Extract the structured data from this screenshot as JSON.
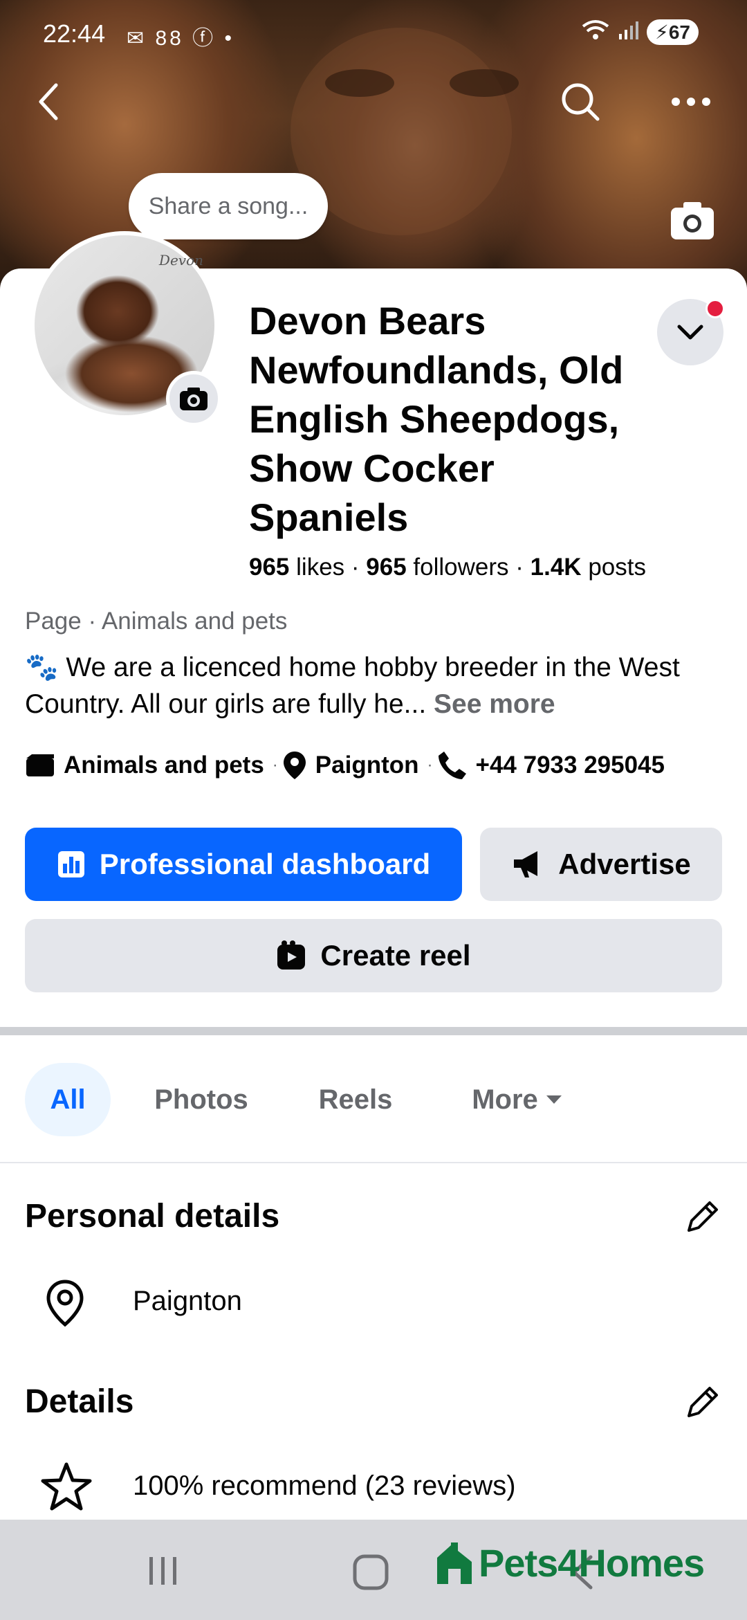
{
  "status_bar": {
    "time": "22:44",
    "notification_icons": "✉ 88 ⓕ •",
    "battery": "67"
  },
  "cover": {
    "song_placeholder": "Share a song..."
  },
  "profile": {
    "avatar_script": "Devon",
    "name": "Devon Bears Newfoundlands, Old English Sheepdogs, Show Cocker Spaniels",
    "likes_count": "965",
    "likes_label": "likes",
    "followers_count": "965",
    "followers_label": "followers",
    "posts_count": "1.4K",
    "posts_label": "posts",
    "category_line": "Page · Animals and pets",
    "bio": "🐾 We are a licenced home hobby breeder in the West Country. All our girls are fully he...",
    "see_more": "See more"
  },
  "info": {
    "category": "Animals and pets",
    "location": "Paignton",
    "phone": "+44 7933 295045"
  },
  "buttons": {
    "dashboard": "Professional dashboard",
    "advertise": "Advertise",
    "create_reel": "Create reel"
  },
  "tabs": [
    {
      "label": "All",
      "active": true
    },
    {
      "label": "Photos",
      "active": false
    },
    {
      "label": "Reels",
      "active": false
    },
    {
      "label": "More",
      "active": false
    }
  ],
  "personal_details": {
    "title": "Personal details",
    "location": "Paignton"
  },
  "details": {
    "title": "Details",
    "recommend": "100% recommend (23 reviews)"
  },
  "watermark": "Pets4Homes",
  "colors": {
    "primary": "#0866ff",
    "secondary_bg": "#e4e6eb",
    "text": "#050505",
    "muted": "#65676b"
  }
}
